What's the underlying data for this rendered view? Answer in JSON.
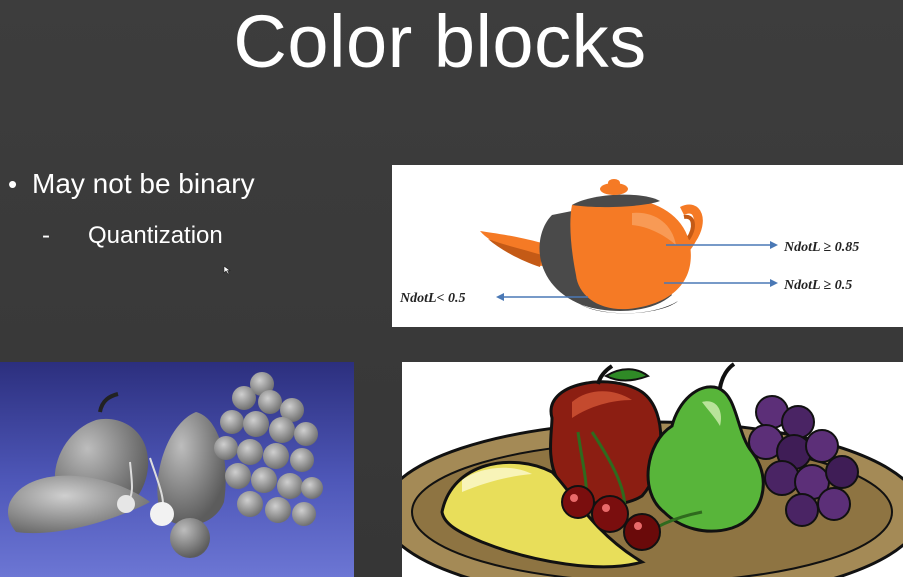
{
  "slide": {
    "title": "Color blocks",
    "bullet": "May not be binary",
    "bullet_marker": "•",
    "sub_bullet": "Quantization",
    "sub_bullet_marker": "-"
  },
  "teapot_figure": {
    "label_top": "NdotL ≥  0.85",
    "label_mid": "NdotL ≥  0.5",
    "label_left": "NdotL< 0.5"
  },
  "colors": {
    "background": "#3a3a3a",
    "text": "#ffffff",
    "teapot_orange": "#f57a25",
    "arrow_blue": "#4a78b5",
    "grey_panel_top": "#2c2f7e",
    "grey_panel_bottom": "#6c76d4"
  }
}
